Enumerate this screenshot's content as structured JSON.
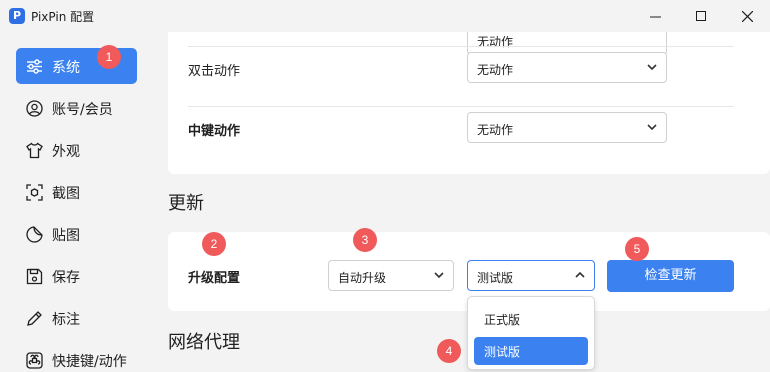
{
  "window": {
    "title": "PixPin 配置",
    "logo_letter": "P"
  },
  "sidebar": {
    "items": [
      {
        "label": "系统",
        "icon": "sliders-icon",
        "active": true
      },
      {
        "label": "账号/会员",
        "icon": "user-icon"
      },
      {
        "label": "外观",
        "icon": "tshirt-icon"
      },
      {
        "label": "截图",
        "icon": "screenshot-icon"
      },
      {
        "label": "贴图",
        "icon": "sticker-icon"
      },
      {
        "label": "保存",
        "icon": "save-icon"
      },
      {
        "label": "标注",
        "icon": "pen-icon"
      },
      {
        "label": "快捷键/动作",
        "icon": "command-icon"
      }
    ]
  },
  "general": {
    "top_select_value": "无动作",
    "double_click": {
      "label": "双击动作",
      "value": "无动作"
    },
    "middle_key": {
      "label": "中键动作",
      "value": "无动作"
    }
  },
  "update": {
    "section_title": "更新",
    "label": "升级配置",
    "mode_value": "自动升级",
    "channel_value": "测试版",
    "check_button": "检查更新",
    "channel_options": [
      "正式版",
      "测试版"
    ],
    "selected_channel": "测试版"
  },
  "proxy": {
    "section_title": "网络代理"
  },
  "badges": [
    "1",
    "2",
    "3",
    "4",
    "5"
  ],
  "colors": {
    "accent": "#3b82f0",
    "badge": "#f05a5a"
  }
}
